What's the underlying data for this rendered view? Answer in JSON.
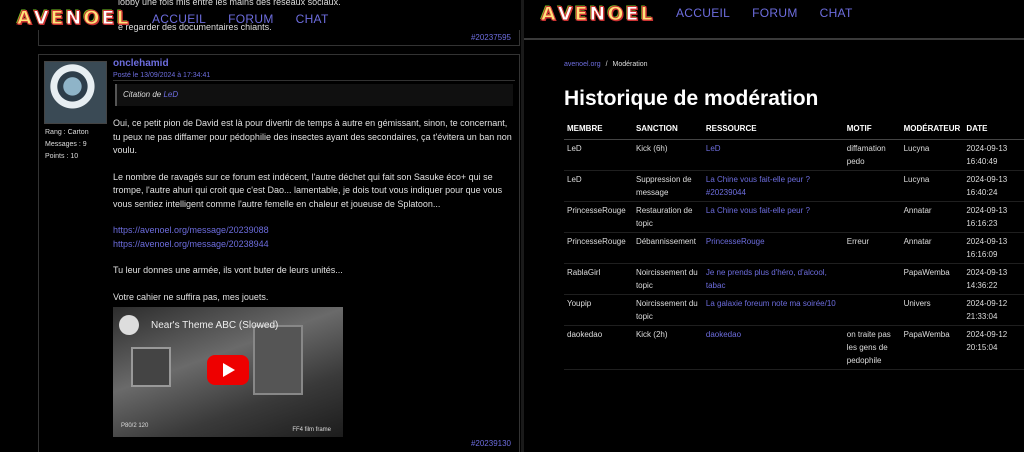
{
  "left": {
    "nav": [
      "ACCUEIL",
      "FORUM",
      "CHAT"
    ],
    "logo_text": "AVENOEL",
    "top_snippet_1": "lobby une fois mis entre les mains des réseaux sociaux.",
    "top_snippet_2": "e regarder des documentaires chiants.",
    "top_post_id": "#20237595",
    "post": {
      "author": "onclehamid",
      "date": "Posté le 13/09/2024 à 17:34:41",
      "rank_label": "Rang",
      "rank_value": "Carton",
      "messages_label": "Messages",
      "messages_value": "9",
      "points_label": "Points",
      "points_value": "10",
      "quote_prefix": "Citation de",
      "quote_author": "LeD",
      "paragraphs": [
        "Oui, ce petit pion de David est là pour divertir de temps à autre en gémissant, sinon, te concernant, tu peux ne pas diffamer pour pédophilie des insectes ayant des secondaires, ça t'évitera un ban non voulu.",
        "Le nombre de ravagés sur ce forum est indécent, l'autre déchet qui fait son Sasuke éco+ qui se trompe, l'autre ahuri qui croit que c'est Dao... lamentable, je dois tout vous indiquer pour que vous vous sentiez intelligent comme l'autre femelle en chaleur et joueuse de Splatoon..."
      ],
      "links": [
        "https://avenoel.org/message/20239088",
        "https://avenoel.org/message/20238944"
      ],
      "paragraph_3": "Tu leur donnes une armée, ils vont buter de leurs unités...",
      "paragraph_4": "Votre cahier ne suffira pas, mes jouets.",
      "video_title": "Near's Theme ABC (Slowed)",
      "video_wm_left": "P80/2 120",
      "video_wm_right": "FF4 film frame",
      "post_id": "#20239130"
    }
  },
  "right": {
    "nav": [
      "ACCUEIL",
      "FORUM",
      "CHAT"
    ],
    "logo_text": "AVENOEL",
    "breadcrumb": {
      "home": "avenoel.org",
      "sep": "/",
      "current": "Modération"
    },
    "title": "Historique de modération",
    "columns": [
      "MEMBRE",
      "SANCTION",
      "RESSOURCE",
      "MOTIF",
      "MODÉRATEUR",
      "DATE"
    ],
    "rows": [
      {
        "member": "LeD",
        "sanction": "Kick (6h)",
        "resource": "LeD",
        "motif": "diffamation pedo",
        "moderator": "Lucyna",
        "date": "2024-09-13 16:40:49"
      },
      {
        "member": "LeD",
        "sanction": "Suppression de message",
        "resource": "La Chine vous fait-elle peur ? #20239044",
        "motif": "",
        "moderator": "Lucyna",
        "date": "2024-09-13 16:40:24"
      },
      {
        "member": "PrincesseRouge",
        "sanction": "Restauration de topic",
        "resource": "La Chine vous fait-elle peur ?",
        "motif": "",
        "moderator": "Annatar",
        "date": "2024-09-13 16:16:23"
      },
      {
        "member": "PrincesseRouge",
        "sanction": "Débannissement",
        "resource": "PrincesseRouge",
        "motif": "Erreur",
        "moderator": "Annatar",
        "date": "2024-09-13 16:16:09"
      },
      {
        "member": "RablaGirl",
        "sanction": "Noircissement du topic",
        "resource": "Je ne prends plus d'héro, d'alcool, tabac",
        "motif": "",
        "moderator": "PapaWemba",
        "date": "2024-09-13 14:36:22"
      },
      {
        "member": "Youpip",
        "sanction": "Noircissement du topic",
        "resource": "La galaxie foreum note ma soirée/10",
        "motif": "",
        "moderator": "Univers",
        "date": "2024-09-12 21:33:04"
      },
      {
        "member": "daokedao",
        "sanction": "Kick (2h)",
        "resource": "daokedao",
        "motif": "on traite pas les gens de pedophile",
        "moderator": "PapaWemba",
        "date": "2024-09-12 20:15:04"
      }
    ]
  },
  "colors": {
    "link": "#6d6dde",
    "background": "#000000",
    "border": "#333333"
  }
}
